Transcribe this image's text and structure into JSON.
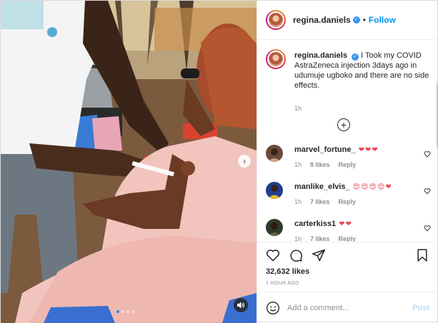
{
  "post": {
    "username": "regina.daniels",
    "follow_label": "Follow",
    "separator": "•",
    "verified_glyph": "✓"
  },
  "caption": {
    "username": "regina.daniels",
    "text": "I Took my COVID AstraZeneca injection 3days ago in udumuje ugboko and there are no side effects.",
    "time": "1h"
  },
  "load_more": {
    "icon": "plus-circle-icon",
    "glyph": "+"
  },
  "comments": [
    {
      "username": "marvel_fortune_",
      "text": "❤❤❤",
      "time": "1h",
      "likes": "8 likes",
      "reply": "Reply"
    },
    {
      "username": "manlike_elvis_",
      "text": "😍😍😍😍❤",
      "time": "1h",
      "likes": "7 likes",
      "reply": "Reply"
    },
    {
      "username": "carterkiss1",
      "text": "❤❤",
      "time": "1h",
      "likes": "7 likes",
      "reply": "Reply"
    }
  ],
  "actions": {
    "likes": "32,632 likes",
    "posted": "1 HOUR AGO"
  },
  "add_comment": {
    "placeholder": "Add a comment...",
    "post_label": "Post"
  },
  "carousel": {
    "next_glyph": "›",
    "active_index": 0,
    "count": 4
  },
  "colors": {
    "accent": "#0095f6",
    "heart": "#ed4956",
    "muted": "#8e8e8e"
  }
}
